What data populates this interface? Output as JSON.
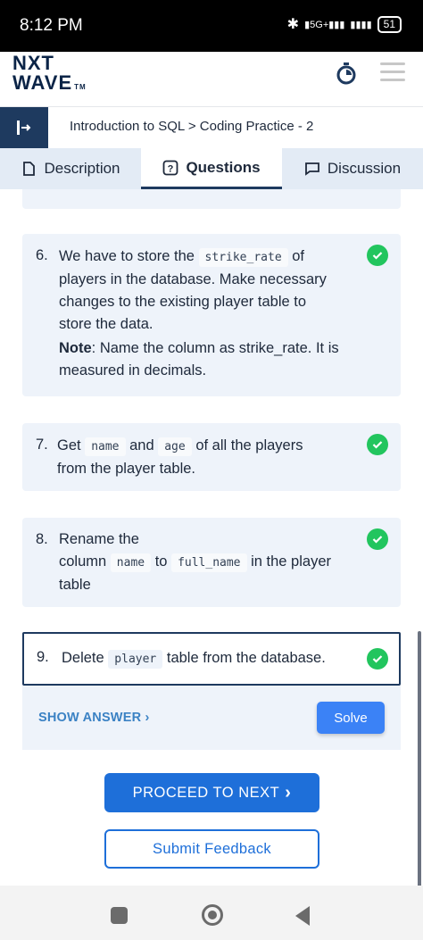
{
  "status_bar": {
    "time": "8:12 PM",
    "signal_text": "5G+",
    "battery": "51"
  },
  "app": {
    "logo_line1": "NXT",
    "logo_line2": "WAVE",
    "logo_tm": "TM"
  },
  "breadcrumb": "Introduction to SQL > Coding Practice - 2",
  "tabs": [
    {
      "label": "Description",
      "icon": "document-icon",
      "active": false
    },
    {
      "label": "Questions",
      "icon": "question-icon",
      "active": true
    },
    {
      "label": "Discussion",
      "icon": "chat-icon",
      "active": false
    }
  ],
  "questions": {
    "q6": {
      "number": "6.",
      "line1_before": "We have to store the",
      "code": "strike_rate",
      "line1_after": "of",
      "line2": "players in the database. Make necessary",
      "line3": "changes to the existing player table to",
      "line4": "store the data.",
      "note_label": "Note",
      "note_line1": ": Name the column as strike_rate. It is",
      "note_line2": "measured in decimals.",
      "status": "completed"
    },
    "q7": {
      "number": "7.",
      "w1": "Get",
      "code1": "name",
      "w2": "and",
      "code2": "age",
      "w3": "of all the players",
      "line2": "from the player table.",
      "status": "completed"
    },
    "q8": {
      "number": "8.",
      "line1": "Rename the",
      "w1": "column",
      "code1": "name",
      "w2": "to",
      "code2": "full_name",
      "w3": "in the player",
      "line3": "table",
      "status": "completed"
    },
    "q9": {
      "number": "9.",
      "w1": "Delete",
      "code": "player",
      "w2": "table from the database.",
      "status": "completed",
      "show_answer": "SHOW ANSWER",
      "solve": "Solve"
    }
  },
  "buttons": {
    "proceed": "PROCEED TO NEXT",
    "feedback": "Submit Feedback"
  },
  "colors": {
    "primary": "#1e6fd9",
    "navy": "#1e3a5f",
    "success": "#22c55e",
    "card_bg": "#eef3fa"
  }
}
